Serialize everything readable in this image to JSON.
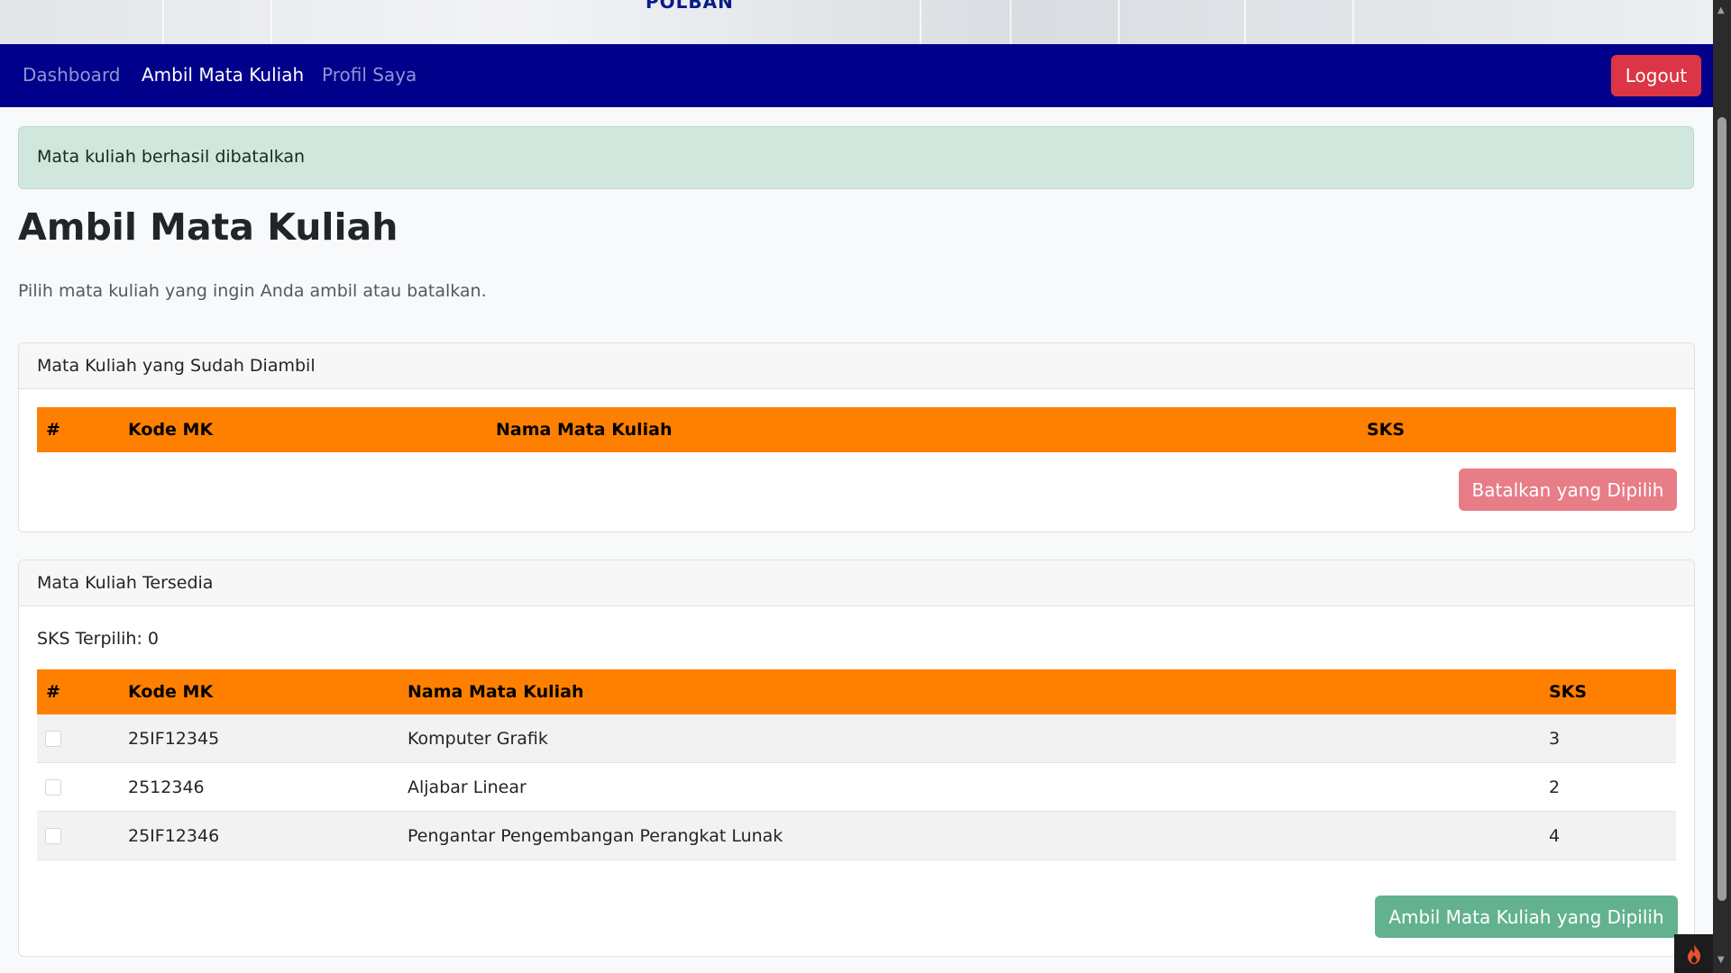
{
  "banner": {
    "brand": "POLBAN"
  },
  "nav": {
    "items": [
      {
        "label": "Dashboard",
        "active": false
      },
      {
        "label": "Ambil Mata Kuliah",
        "active": true
      },
      {
        "label": "Profil Saya",
        "active": false
      }
    ],
    "logout_label": "Logout"
  },
  "alert": {
    "message": "Mata kuliah berhasil dibatalkan"
  },
  "page": {
    "title": "Ambil Mata Kuliah",
    "subtitle": "Pilih mata kuliah yang ingin Anda ambil atau batalkan."
  },
  "taken_card": {
    "header": "Mata Kuliah yang Sudah Diambil",
    "columns": [
      "#",
      "Kode MK",
      "Nama Mata Kuliah",
      "SKS"
    ],
    "rows": [],
    "cancel_button": "Batalkan yang Dipilih"
  },
  "available_card": {
    "header": "Mata Kuliah Tersedia",
    "sks_selected": "SKS Terpilih: 0",
    "columns": [
      "#",
      "Kode MK",
      "Nama Mata Kuliah",
      "SKS"
    ],
    "rows": [
      {
        "code": "25IF12345",
        "name": "Komputer Grafik",
        "sks": "3"
      },
      {
        "code": "2512346",
        "name": "Aljabar Linear",
        "sks": "2"
      },
      {
        "code": "25IF12346",
        "name": "Pengantar Pengembangan Perangkat Lunak",
        "sks": "4"
      }
    ],
    "take_button": "Ambil Mata Kuliah yang Dipilih"
  },
  "colors": {
    "navbar": "#00008b",
    "table_header": "#ff8000",
    "alert_bg": "#d1e7dd",
    "logout": "#dc3545",
    "cancel_button": "#e87c87",
    "take_button": "#63b28f"
  },
  "icons": {
    "corner_widget": "flame-icon"
  }
}
